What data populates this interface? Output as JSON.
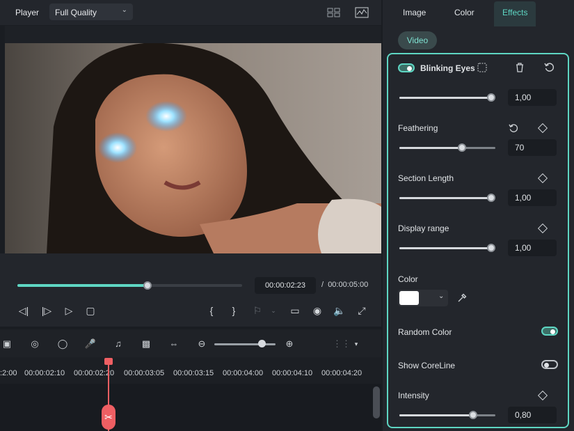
{
  "player": {
    "label": "Player",
    "quality": "Full Quality"
  },
  "playback": {
    "current_time": "00:00:02:23",
    "separator": "/",
    "total_time": "00:00:05:00",
    "progress": 0.58
  },
  "ruler": {
    "labels": [
      ":2:00",
      "00:00:02:10",
      "00:00:02:20",
      "00:00:03:05",
      "00:00:03:15",
      "00:00:04:00",
      "00:00:04:10",
      "00:00:04:20"
    ]
  },
  "tabs": {
    "image": "Image",
    "color": "Color",
    "effects": "Effects",
    "active": "Effects"
  },
  "subtab": {
    "video": "Video"
  },
  "effect": {
    "name": "Blinking Eyes",
    "enabled": true,
    "params": [
      {
        "label": "",
        "value": "1,00",
        "fill": 1.0
      },
      {
        "label": "Feathering",
        "value": "70",
        "fill": 0.68
      },
      {
        "label": "Section Length",
        "value": "1,00",
        "fill": 1.0
      },
      {
        "label": "Display range",
        "value": "1,00",
        "fill": 1.0
      }
    ],
    "color_label": "Color",
    "color_value": "#ffffff",
    "random_color": {
      "label": "Random Color",
      "on": true
    },
    "show_coreline": {
      "label": "Show CoreLine",
      "on": false
    },
    "intensity": {
      "label": "Intensity",
      "value": "0,80",
      "fill": 0.8
    }
  },
  "colors": {
    "accent": "#5ed6c3",
    "playhead": "#ef5f63"
  }
}
